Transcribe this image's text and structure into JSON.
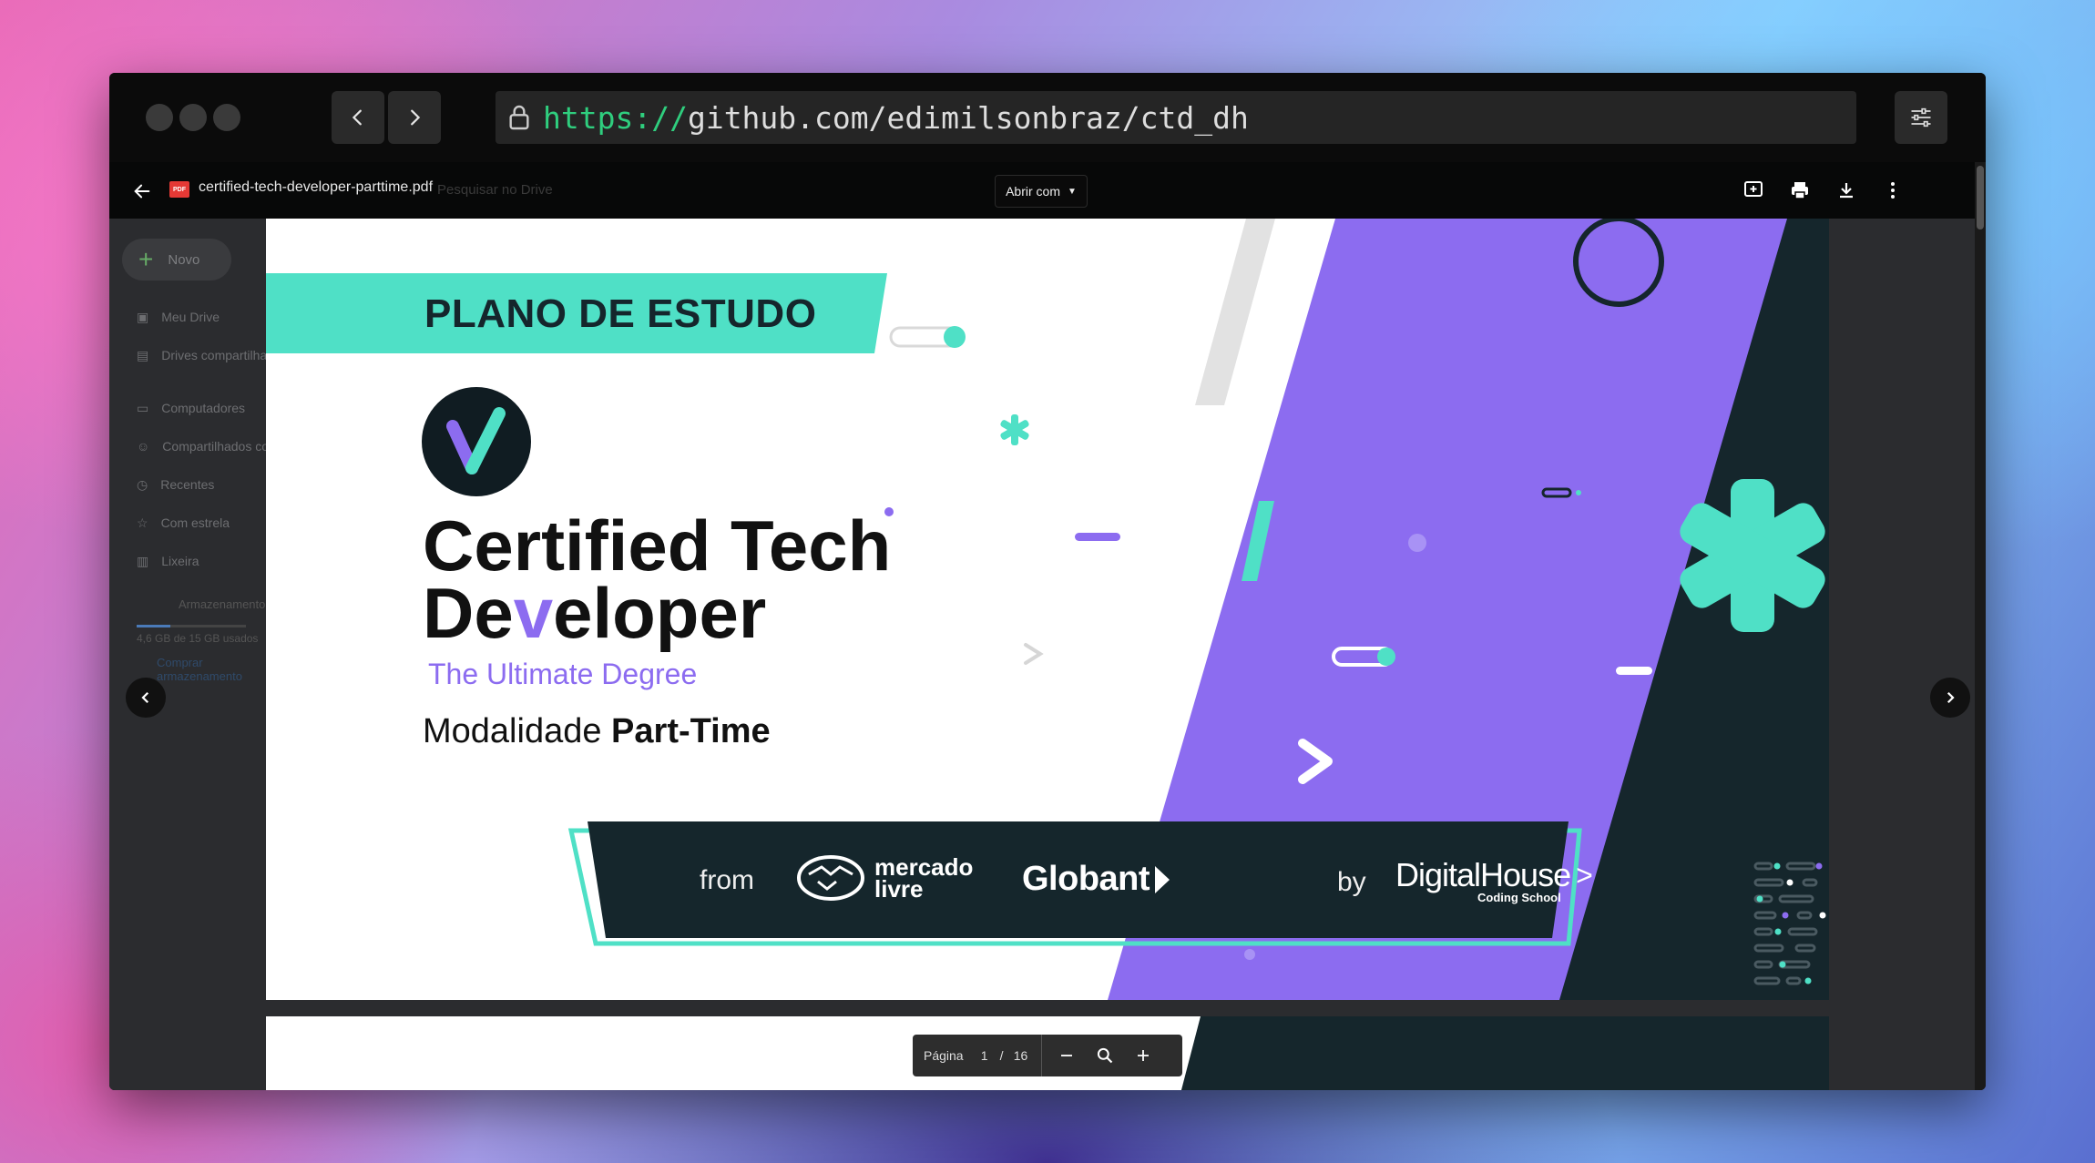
{
  "browser": {
    "url_scheme": "https://",
    "url_rest": "github.com/edimilsonbraz/ctd_dh"
  },
  "viewer": {
    "file_name": "certified-tech-developer-parttime.pdf",
    "ghost_search": "Pesquisar no Drive",
    "open_with": "Abrir com"
  },
  "drive_sidebar": {
    "new_button": "Novo",
    "items": [
      "Meu Drive",
      "Drives compartilhados",
      "Computadores",
      "Compartilhados comigo",
      "Recentes",
      "Com estrela",
      "Lixeira"
    ],
    "storage_label": "Armazenamento",
    "storage_used": "4,6 GB de 15 GB usados",
    "buy_storage": "Comprar armazenamento"
  },
  "slide": {
    "banner": "PLANO DE ESTUDO",
    "title_line1": "Certified Tech",
    "title_line2_a": "De",
    "title_line2_v": "v",
    "title_line2_b": "eloper",
    "subtitle": "The Ultimate Degree",
    "modality_prefix": "Modalidade ",
    "modality_bold": "Part-Time",
    "from": "from",
    "mercado_line1": "mercado",
    "mercado_line2": "livre",
    "globant": "Globant",
    "by": "by",
    "dh_main": "DigitalHouse",
    "dh_sub": "Coding School",
    "logo_letter": "V"
  },
  "pager": {
    "label": "Página",
    "current": "1",
    "sep": "/",
    "total": "16"
  },
  "colors": {
    "teal": "#4fe0c6",
    "purple": "#8c6cf0",
    "navy": "#15262c",
    "accent_green": "#2fce7e"
  }
}
